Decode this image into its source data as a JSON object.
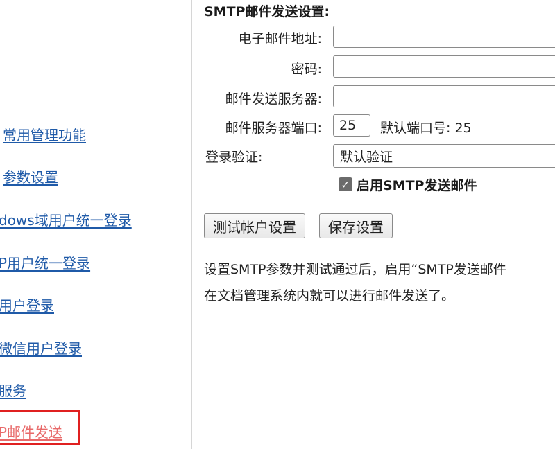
{
  "sidebar": {
    "items": [
      {
        "label": "常用管理功能"
      },
      {
        "label": "参数设置"
      },
      {
        "label": "dows域用户统一登录"
      },
      {
        "label": "P用户统一登录"
      },
      {
        "label": "用户登录"
      },
      {
        "label": "微信用户登录"
      },
      {
        "label": "服务"
      },
      {
        "label": "P邮件发送"
      }
    ],
    "active_index": 7,
    "highlight_color": "#e02020"
  },
  "smtp": {
    "title": "SMTP邮件发送设置:",
    "email_label": "电子邮件地址:",
    "email_value": "",
    "password_label": "密码:",
    "password_value": "",
    "server_label": "邮件发送服务器:",
    "server_value": "",
    "port_label": "邮件服务器端口:",
    "port_value": "25",
    "default_port_text": "默认端口号: 25",
    "auth_label": "登录验证:",
    "auth_value": "默认验证",
    "enable_checked": true,
    "enable_label": "启用SMTP发送邮件"
  },
  "buttons": {
    "test_label": "测试帐户设置",
    "save_label": "保存设置"
  },
  "description": {
    "line1": "设置SMTP参数并测试通过后，启用“SMTP发送邮件",
    "line2": "在文档管理系统内就可以进行邮件发送了。"
  }
}
